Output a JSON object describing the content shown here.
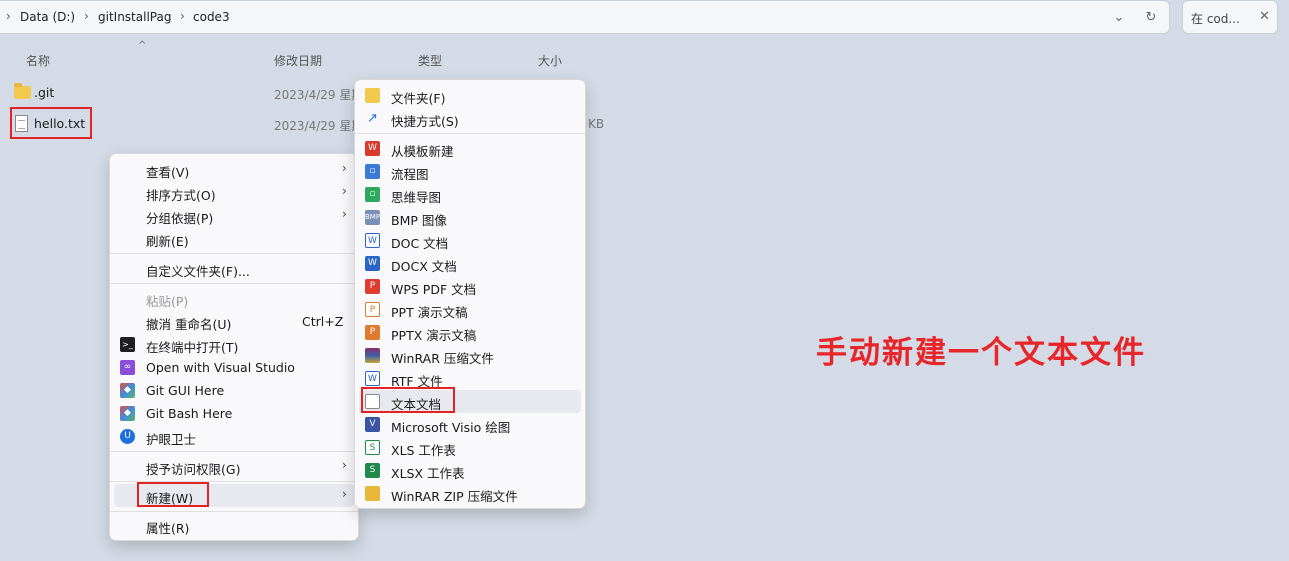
{
  "breadcrumb": {
    "items": [
      "Data (D:)",
      "gitInstallPag",
      "code3"
    ]
  },
  "address_buttons": {
    "dropdown": "⌄",
    "refresh": "↻"
  },
  "search": {
    "placeholder": "在 cod..."
  },
  "columns": {
    "name": "名称",
    "modified": "修改日期",
    "type": "类型",
    "size": "大小"
  },
  "files": [
    {
      "name": ".git",
      "date": "2023/4/29 星期",
      "icon": "folder-icon"
    },
    {
      "name": "hello.txt",
      "date": "2023/4/29 星期",
      "icon": "text-file-icon",
      "size": "KB"
    }
  ],
  "context_menu": {
    "view": "查看(V)",
    "sort": "排序方式(O)",
    "group": "分组依据(P)",
    "refresh": "刷新(E)",
    "customize": "自定义文件夹(F)...",
    "paste": "粘贴(P)",
    "undo": "撤消 重命名(U)",
    "undo_shortcut": "Ctrl+Z",
    "open_terminal": "在终端中打开(T)",
    "open_vs": "Open with Visual Studio",
    "git_gui": "Git GUI Here",
    "git_bash": "Git Bash Here",
    "eye_guard": "护眼卫士",
    "grant_access": "授予访问权限(G)",
    "new": "新建(W)",
    "properties": "属性(R)"
  },
  "new_submenu": {
    "folder": "文件夹(F)",
    "shortcut": "快捷方式(S)",
    "from_template": "从模板新建",
    "flowchart": "流程图",
    "mindmap": "思维导图",
    "bmp": "BMP 图像",
    "doc": "DOC 文档",
    "docx": "DOCX 文档",
    "wps_pdf": "WPS PDF 文档",
    "ppt": "PPT 演示文稿",
    "pptx": "PPTX 演示文稿",
    "winrar": "WinRAR 压缩文件",
    "rtf": "RTF 文件",
    "text_doc": "文本文档",
    "visio": "Microsoft Visio 绘图",
    "xls": "XLS 工作表",
    "xlsx": "XLSX 工作表",
    "winrar_zip": "WinRAR ZIP 压缩文件"
  },
  "annotation": "手动新建一个文本文件",
  "colors": {
    "highlight": "#e02424",
    "annotation": "#e8262a",
    "background": "#d4dbe6"
  }
}
